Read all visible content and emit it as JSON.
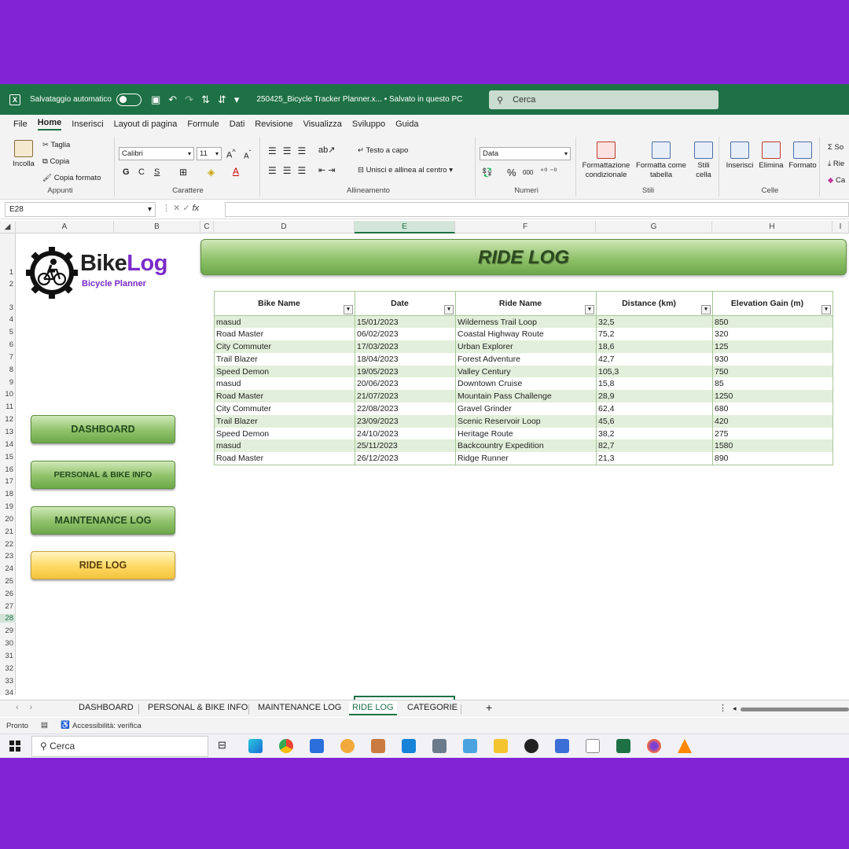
{
  "titlebar": {
    "autosave_label": "Salvataggio automatico",
    "file_title": "250425_Bicycle Tracker Planner.x...  •  Salvato in questo PC",
    "search_placeholder": "Cerca"
  },
  "menu": [
    "File",
    "Home",
    "Inserisci",
    "Layout di pagina",
    "Formule",
    "Dati",
    "Revisione",
    "Visualizza",
    "Sviluppo",
    "Guida"
  ],
  "ribbon": {
    "clipboard": {
      "label": "Appunti",
      "paste": "Incolla",
      "cut": "Taglia",
      "copy": "Copia",
      "format_painter": "Copia formato"
    },
    "font": {
      "label": "Carattere",
      "name": "Calibri",
      "size": "11",
      "bold": "G",
      "italic": "C",
      "underline": "S"
    },
    "alignment": {
      "label": "Allineamento",
      "wrap": "Testo a capo",
      "merge": "Unisci e allinea al centro"
    },
    "number": {
      "label": "Numeri",
      "format": "Data",
      "percent": "%",
      "thousands": "000"
    },
    "styles": {
      "label": "Stili",
      "conditional": "Formattazione condizionale",
      "as_table": "Formatta come tabella",
      "cell_styles": "Stili cella"
    },
    "cells": {
      "label": "Celle",
      "insert": "Inserisci",
      "delete": "Elimina",
      "format": "Formato"
    },
    "editing": {
      "sum": "So",
      "fill": "Rie",
      "clear": "Ca"
    }
  },
  "formula_bar": {
    "name_box": "E28",
    "fx": "fx",
    "value": ""
  },
  "columns": [
    "A",
    "B",
    "C",
    "D",
    "E",
    "F",
    "G",
    "H",
    "I"
  ],
  "active_column": "E",
  "active_row": "28",
  "logo": {
    "title_a": "Bike",
    "title_b": "Log",
    "subtitle": "Bicycle Planner"
  },
  "nav": {
    "dashboard": "DASHBOARD",
    "personal": "PERSONAL & BIKE INFO",
    "maintenance": "MAINTENANCE LOG",
    "ride": "RIDE LOG"
  },
  "banner": "RIDE LOG",
  "table": {
    "headers": [
      "Bike Name",
      "Date",
      "Ride Name",
      "Distance (km)",
      "Elevation Gain (m)"
    ],
    "rows": [
      [
        "masud",
        "15/01/2023",
        "Wilderness Trail Loop",
        "32,5",
        "850"
      ],
      [
        "Road Master",
        "06/02/2023",
        "Coastal Highway Route",
        "75,2",
        "320"
      ],
      [
        "City Commuter",
        "17/03/2023",
        "Urban Explorer",
        "18,6",
        "125"
      ],
      [
        "Trail Blazer",
        "18/04/2023",
        "Forest Adventure",
        "42,7",
        "930"
      ],
      [
        "Speed Demon",
        "19/05/2023",
        "Valley Century",
        "105,3",
        "750"
      ],
      [
        "masud",
        "20/06/2023",
        "Downtown Cruise",
        "15,8",
        "85"
      ],
      [
        "Road Master",
        "21/07/2023",
        "Mountain Pass Challenge",
        "28,9",
        "1250"
      ],
      [
        "City Commuter",
        "22/08/2023",
        "Gravel Grinder",
        "62,4",
        "680"
      ],
      [
        "Trail Blazer",
        "23/09/2023",
        "Scenic Reservoir Loop",
        "45,6",
        "420"
      ],
      [
        "Speed Demon",
        "24/10/2023",
        "Heritage Route",
        "38,2",
        "275"
      ],
      [
        "masud",
        "25/11/2023",
        "Backcountry Expedition",
        "82,7",
        "1580"
      ],
      [
        "Road Master",
        "26/12/2023",
        "Ridge Runner",
        "21,3",
        "890"
      ]
    ]
  },
  "sheet_tabs": [
    "DASHBOARD",
    "PERSONAL & BIKE INFO",
    "MAINTENANCE LOG",
    "RIDE LOG",
    "CATEGORIE"
  ],
  "active_tab": "RIDE LOG",
  "statusbar": {
    "ready": "Pronto",
    "accessibility": "Accessibilità: verifica"
  },
  "taskbar": {
    "search": "Cerca"
  },
  "colors": {
    "excel_green": "#1e7145",
    "background": "#8224d6",
    "brand_purple": "#7a2bc8",
    "row_band": "#e2efda"
  }
}
